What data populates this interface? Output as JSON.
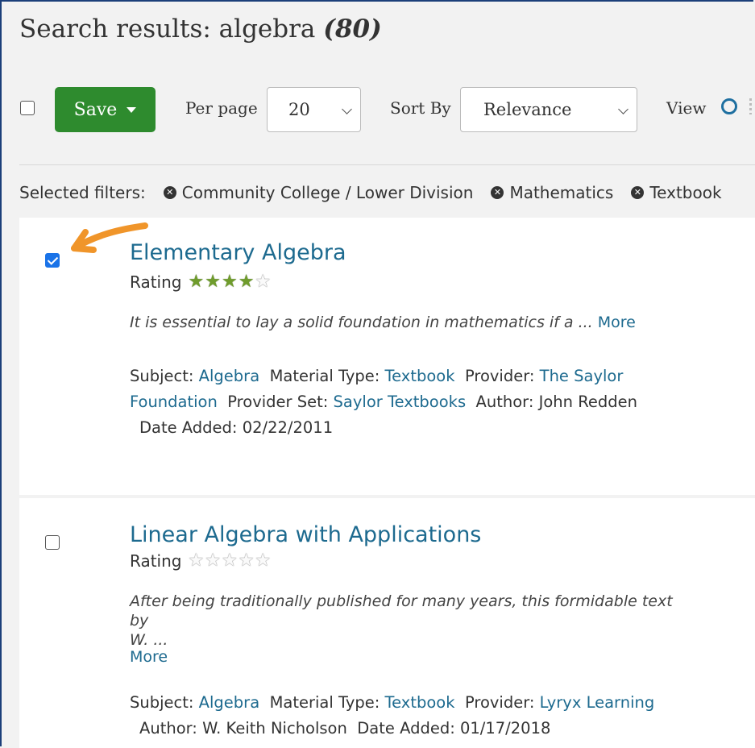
{
  "header": {
    "title_prefix": "Search results: algebra",
    "count": "(80)"
  },
  "toolbar": {
    "save_label": "Save",
    "per_page_label": "Per page",
    "per_page_value": "20",
    "sort_by_label": "Sort By",
    "sort_value": "Relevance",
    "view_label": "View"
  },
  "filters": {
    "label": "Selected filters:",
    "chips": [
      "Community College / Lower Division",
      "Mathematics",
      "Textbook"
    ]
  },
  "results": [
    {
      "title": "Elementary Algebra",
      "rating_label": "Rating",
      "rating": 4,
      "rating_max": 5,
      "checked": true,
      "description": "It is essential to lay a solid foundation in mathematics if a ...",
      "more": "More",
      "subject_label": "Subject:",
      "subject": "Algebra",
      "material_label": "Material Type:",
      "material": "Textbook",
      "provider_label": "Provider:",
      "provider": "The Saylor Foundation",
      "provider_set_label": "Provider Set:",
      "provider_set": "Saylor Textbooks",
      "author_label": "Author:",
      "author": "John Redden",
      "date_label": "Date Added:",
      "date": "02/22/2011"
    },
    {
      "title": "Linear Algebra with Applications",
      "rating_label": "Rating",
      "rating": 0,
      "rating_max": 5,
      "checked": false,
      "description_line1": "After being traditionally published for many years, this formidable text by",
      "description_line2": "W. ...",
      "more": "More",
      "subject_label": "Subject:",
      "subject": "Algebra",
      "material_label": "Material Type:",
      "material": "Textbook",
      "provider_label": "Provider:",
      "provider": "Lyryx Learning",
      "author_label": "Author:",
      "author": "W. Keith Nicholson",
      "date_label": "Date Added:",
      "date": "01/17/2018"
    }
  ],
  "colors": {
    "accent": "#1d6a8f",
    "save": "#2e8b2e",
    "arrow": "#f0952a"
  }
}
